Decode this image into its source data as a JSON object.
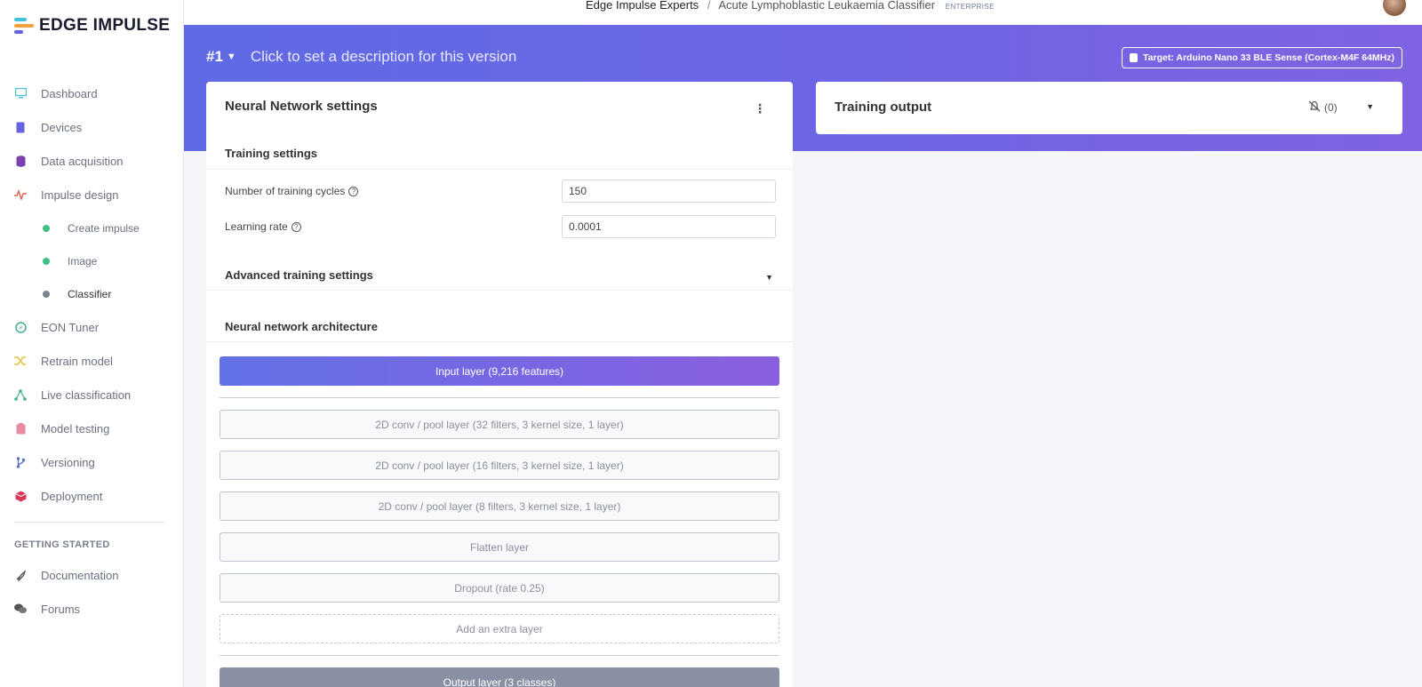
{
  "brand": {
    "name": "EDGE IMPULSE"
  },
  "topbar": {
    "org": "Edge Impulse Experts",
    "separator": "/",
    "project": "Acute Lymphoblastic Leukaemia Classifier",
    "badge": "ENTERPRISE"
  },
  "sidebar": {
    "items": [
      {
        "label": "Dashboard",
        "icon": "monitor-icon",
        "color": "#4fc1d9"
      },
      {
        "label": "Devices",
        "icon": "chip-icon",
        "color": "#6a63e0"
      },
      {
        "label": "Data acquisition",
        "icon": "database-icon",
        "color": "#7a3fb0"
      },
      {
        "label": "Impulse design",
        "icon": "pulse-icon",
        "color": "#e0664c"
      }
    ],
    "subitems": [
      {
        "label": "Create impulse",
        "dot": "#3fc087"
      },
      {
        "label": "Image",
        "dot": "#3fc087"
      },
      {
        "label": "Classifier",
        "dot": "#7d8291"
      }
    ],
    "items2": [
      {
        "label": "EON Tuner",
        "icon": "compass-icon",
        "color": "#3fb08a"
      },
      {
        "label": "Retrain model",
        "icon": "shuffle-icon",
        "color": "#e6c23a"
      },
      {
        "label": "Live classification",
        "icon": "network-icon",
        "color": "#3fb08a"
      },
      {
        "label": "Model testing",
        "icon": "clipboard-icon",
        "color": "#e88aa0"
      },
      {
        "label": "Versioning",
        "icon": "branch-icon",
        "color": "#5a6fd0"
      },
      {
        "label": "Deployment",
        "icon": "box-icon",
        "color": "#d93a5a"
      }
    ],
    "heading": "GETTING STARTED",
    "items3": [
      {
        "label": "Documentation",
        "icon": "rocket-icon",
        "color": "#555"
      },
      {
        "label": "Forums",
        "icon": "chat-icon",
        "color": "#555"
      }
    ]
  },
  "banner": {
    "version": "#1",
    "description": "Click to set a description for this version",
    "target": "Target: Arduino Nano 33 BLE Sense (Cortex-M4F 64MHz)"
  },
  "nn": {
    "title": "Neural Network settings",
    "training_title": "Training settings",
    "cycles_label": "Number of training cycles",
    "cycles_value": "150",
    "lr_label": "Learning rate",
    "lr_value": "0.0001",
    "advanced": "Advanced training settings",
    "arch_title": "Neural network architecture",
    "input_layer": "Input layer (9,216 features)",
    "layers": [
      "2D conv / pool layer (32 filters, 3 kernel size, 1 layer)",
      "2D conv / pool layer (16 filters, 3 kernel size, 1 layer)",
      "2D conv / pool layer (8 filters, 3 kernel size, 1 layer)",
      "Flatten layer",
      "Dropout (rate 0.25)"
    ],
    "add_layer": "Add an extra layer",
    "output_layer": "Output layer (3 classes)"
  },
  "output": {
    "title": "Training output",
    "notifications": "(0)"
  }
}
